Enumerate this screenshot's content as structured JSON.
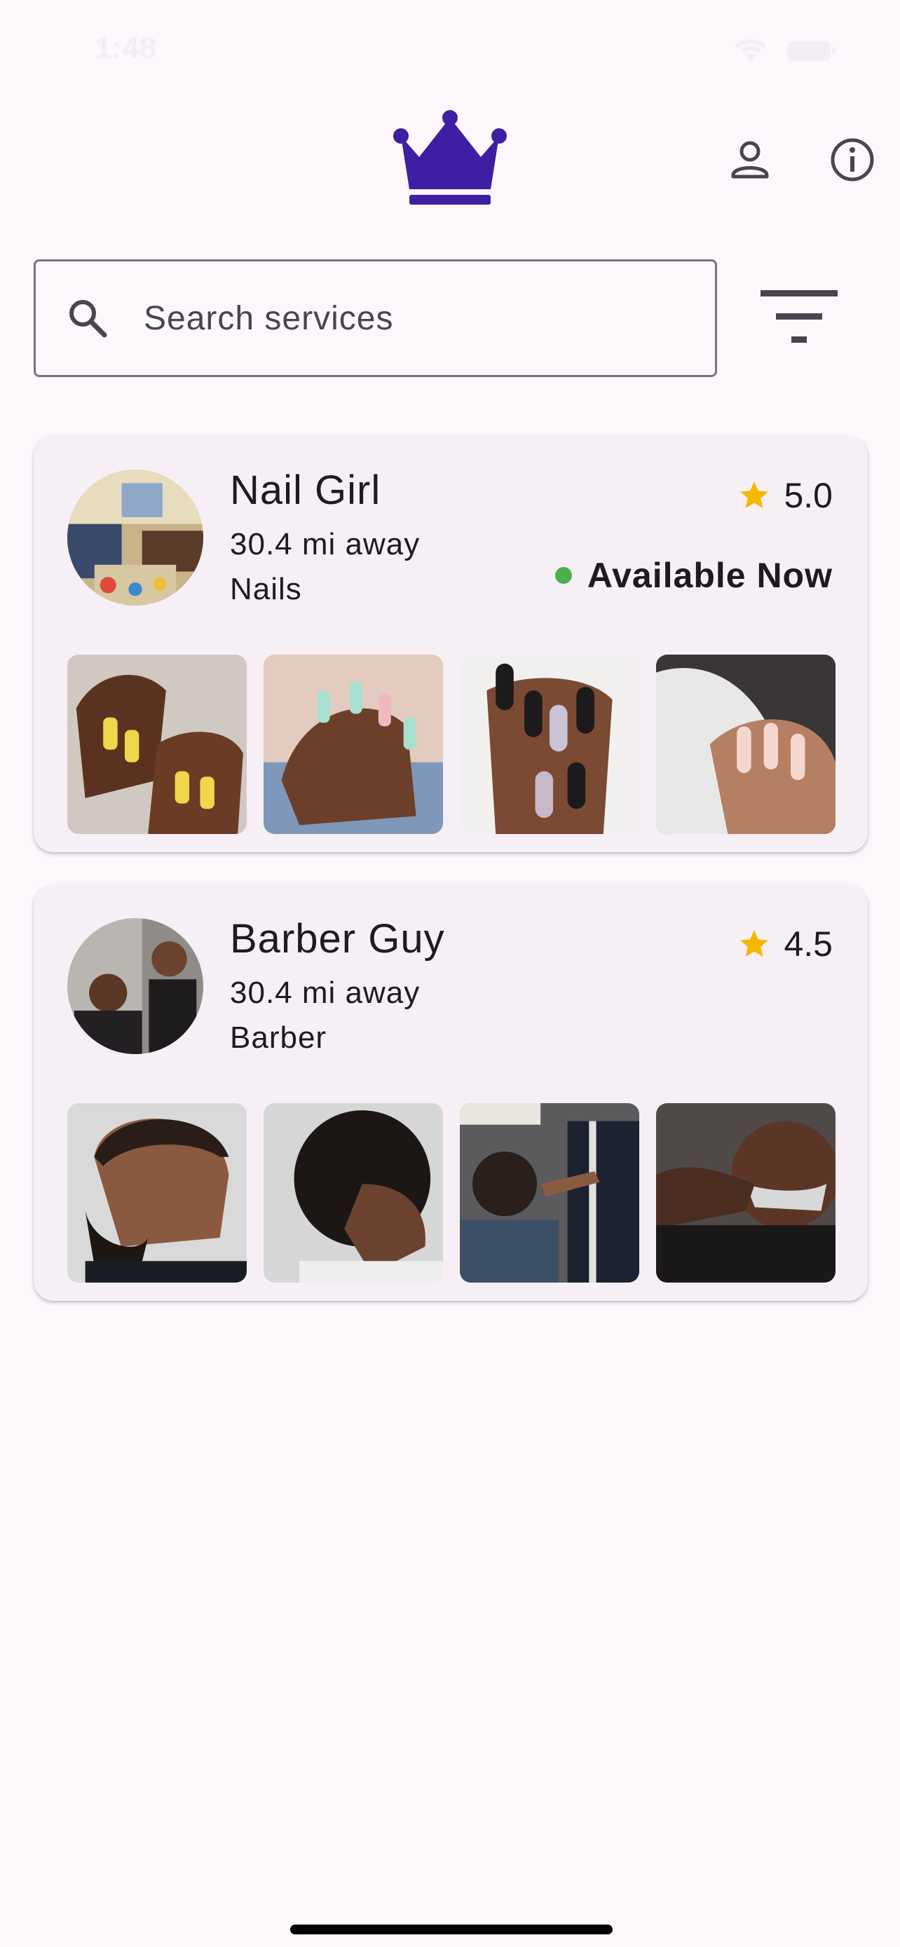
{
  "status_bar": {
    "time": "1:48"
  },
  "header": {
    "logo_icon": "crown-icon",
    "profile_icon": "person-icon",
    "info_icon": "info-icon"
  },
  "search": {
    "placeholder": "Search services",
    "value": "",
    "icon": "search-icon"
  },
  "filter": {
    "icon": "filter-icon"
  },
  "colors": {
    "brand": "#3d1fa3",
    "star": "#f5b700",
    "available": "#4caf50",
    "background": "#fdf7fc"
  },
  "providers": [
    {
      "name": "Nail Girl",
      "distance": "30.4 mi away",
      "category": "Nails",
      "rating": "5.0",
      "availability": "Available Now"
    },
    {
      "name": "Barber Guy",
      "distance": "30.4 mi away",
      "category": "Barber",
      "rating": "4.5"
    }
  ]
}
